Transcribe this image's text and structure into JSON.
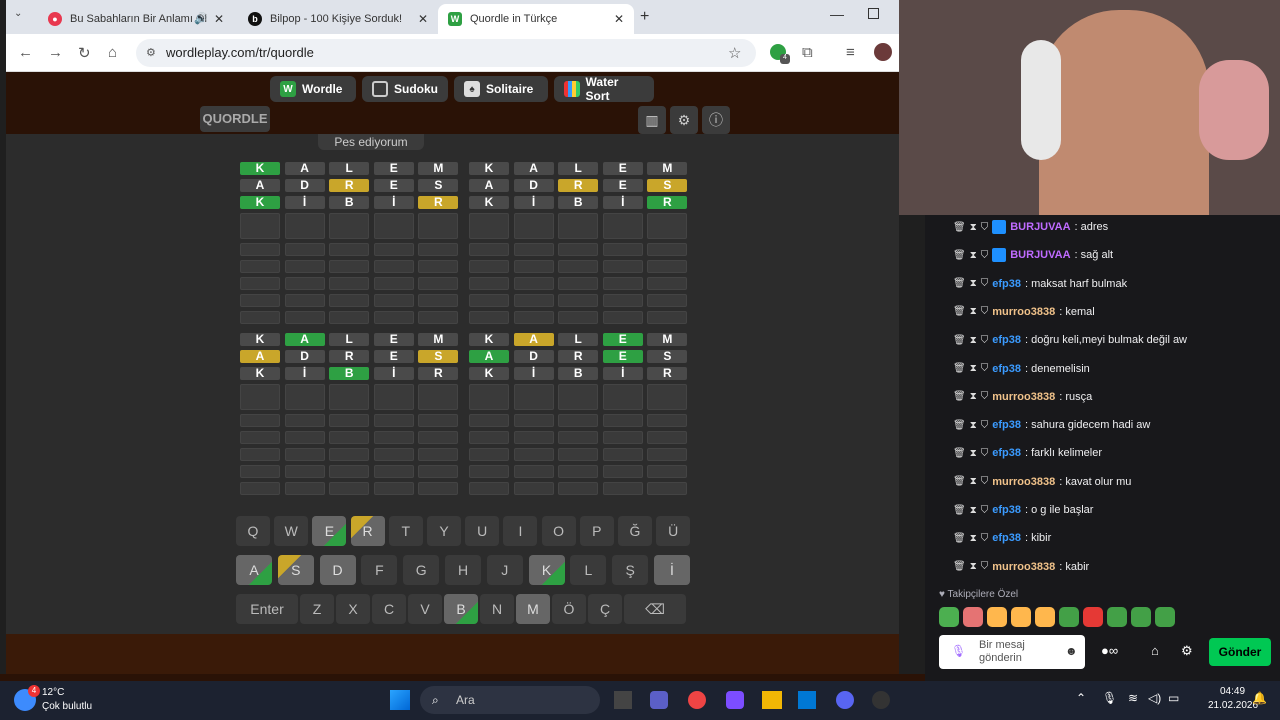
{
  "browser": {
    "tabs": [
      {
        "title": "Bu Sabahların Bir Anlamı Ol",
        "icon": "youtube-music-icon",
        "color": "#e8384f"
      },
      {
        "title": "Bilpop - 100 Kişiye Sorduk!",
        "icon": "bilpop-icon",
        "color": "#111111"
      },
      {
        "title": "Quordle in Türkçe",
        "icon": "wordleplay-icon",
        "color": "#2ea043"
      }
    ],
    "url": "wordleplay.com/tr/quordle",
    "extension_badge": "4"
  },
  "game_nav": [
    {
      "label": "Wordle",
      "icon": "W",
      "color": "#2ea043"
    },
    {
      "label": "Sudoku",
      "icon": "grid-icon"
    },
    {
      "label": "Solitaire",
      "icon": "cards-icon"
    },
    {
      "label": "Water Sort",
      "icon": "tubes-icon"
    }
  ],
  "title": "QUORDLE",
  "give_up": "Pes ediyorum",
  "boards": [
    {
      "rows": [
        [
          "K:g",
          "A:k",
          "L:k",
          "E:k",
          "M:k"
        ],
        [
          "A:k",
          "D:k",
          "R:y",
          "E:k",
          "S:k"
        ],
        [
          "K:g",
          "İ:k",
          "B:k",
          "İ:k",
          "R:y"
        ]
      ]
    },
    {
      "rows": [
        [
          "K:k",
          "A:k",
          "L:k",
          "E:k",
          "M:k"
        ],
        [
          "A:k",
          "D:k",
          "R:y",
          "E:k",
          "S:y"
        ],
        [
          "K:k",
          "İ:k",
          "B:k",
          "İ:k",
          "R:g"
        ]
      ]
    },
    {
      "rows": [
        [
          "K:k",
          "A:g",
          "L:k",
          "E:k",
          "M:k"
        ],
        [
          "A:y",
          "D:k",
          "R:k",
          "E:k",
          "S:y"
        ],
        [
          "K:k",
          "İ:k",
          "B:g",
          "İ:k",
          "R:k"
        ]
      ]
    },
    {
      "rows": [
        [
          "K:k",
          "A:y",
          "L:k",
          "E:g",
          "M:k"
        ],
        [
          "A:g",
          "D:k",
          "R:k",
          "E:g",
          "S:k"
        ],
        [
          "K:k",
          "İ:k",
          "B:k",
          "İ:k",
          "R:k"
        ]
      ]
    }
  ],
  "keyboard": [
    [
      "Q",
      "W",
      "E",
      "R",
      "T",
      "Y",
      "U",
      "I",
      "O",
      "P",
      "Ğ",
      "Ü"
    ],
    [
      "A",
      "S",
      "D",
      "F",
      "G",
      "H",
      "J",
      "K",
      "L",
      "Ş",
      "İ"
    ],
    [
      "Enter",
      "Z",
      "X",
      "C",
      "V",
      "B",
      "N",
      "M",
      "Ö",
      "Ç",
      "⌫"
    ]
  ],
  "chat": {
    "messages": [
      {
        "user": "BURJUVAA",
        "text": "adres",
        "color": "#bf6bff"
      },
      {
        "user": "BURJUVAA",
        "text": "sağ alt",
        "color": "#bf6bff"
      },
      {
        "user": "efp38",
        "text": "maksat harf bulmak",
        "color": "#3b9bff"
      },
      {
        "user": "murroo3838",
        "text": "kemal",
        "color": "#f0c28a"
      },
      {
        "user": "efp38",
        "text": "doğru keli,meyi bulmak değil aw",
        "color": "#3b9bff"
      },
      {
        "user": "efp38",
        "text": "denemelisin",
        "color": "#3b9bff"
      },
      {
        "user": "murroo3838",
        "text": "rusça",
        "color": "#f0c28a"
      },
      {
        "user": "efp38",
        "text": "sahura gidecem hadi aw",
        "color": "#3b9bff"
      },
      {
        "user": "efp38",
        "text": "farklı kelimeler",
        "color": "#3b9bff"
      },
      {
        "user": "murroo3838",
        "text": "kavat olur mu",
        "color": "#f0c28a"
      },
      {
        "user": "efp38",
        "text": "o g ile başlar",
        "color": "#3b9bff"
      },
      {
        "user": "efp38",
        "text": "kibir",
        "color": "#3b9bff"
      },
      {
        "user": "murroo3838",
        "text": "kabir",
        "color": "#f0c28a"
      }
    ],
    "followers_label": "Takipçilere Özel",
    "input_placeholder": "Bir mesaj gönderin",
    "send_label": "Gönder"
  },
  "taskbar": {
    "weather_temp": "12°C",
    "weather_desc": "Çok bulutlu",
    "weather_badge": "4",
    "search": "Ara",
    "time": "04:49",
    "date": "21.02.2026"
  }
}
